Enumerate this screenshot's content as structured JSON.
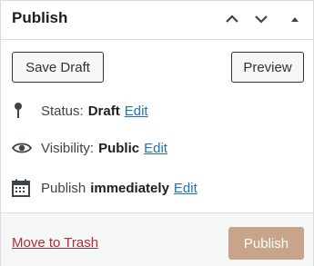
{
  "panel": {
    "title": "Publish",
    "controls": [
      "chevron-up-icon",
      "chevron-down-icon",
      "triangle-up-icon"
    ]
  },
  "actions": {
    "save_draft": "Save Draft",
    "preview": "Preview"
  },
  "status": {
    "label": "Status:",
    "value": "Draft",
    "edit": "Edit",
    "icon": "pin-icon"
  },
  "visibility": {
    "label": "Visibility:",
    "value": "Public",
    "edit": "Edit",
    "icon": "eye-icon"
  },
  "schedule": {
    "label": "Publish",
    "value": "immediately",
    "edit": "Edit",
    "icon": "calendar-icon"
  },
  "footer": {
    "trash": "Move to Trash",
    "publish": "Publish"
  },
  "colors": {
    "link": "#2271b1",
    "trash": "#b32d2e",
    "publish_bg": "#c8a48a"
  }
}
